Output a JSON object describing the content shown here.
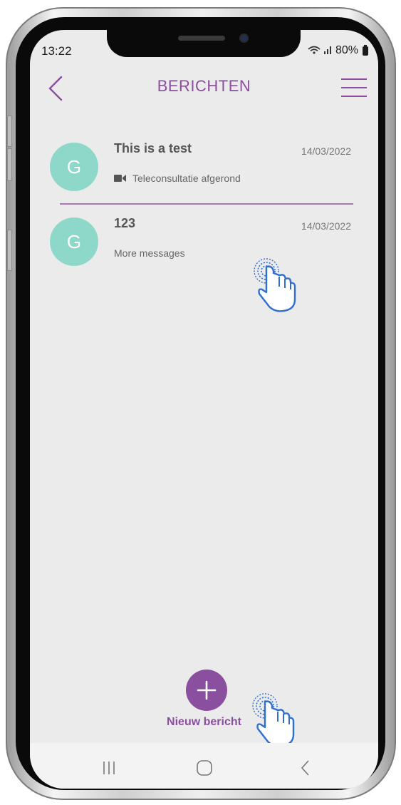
{
  "status_bar": {
    "time": "13:22",
    "battery": "80%",
    "icons": "wifi-icon signal-icon battery-icon"
  },
  "header": {
    "title": "BERICHTEN",
    "back_icon": "chevron-left-icon",
    "menu_icon": "hamburger-menu-icon"
  },
  "messages": [
    {
      "avatar_letter": "G",
      "title": "This is a test",
      "date": "14/03/2022",
      "preview": "Teleconsultatie afgerond",
      "preview_icon": "video-camera-icon"
    },
    {
      "avatar_letter": "G",
      "title": "123",
      "date": "14/03/2022",
      "preview": "More messages"
    }
  ],
  "new_message": {
    "label": "Nieuw bericht",
    "icon": "plus-icon"
  },
  "colors": {
    "accent": "#8a4f9e",
    "avatar": "#8ed8c9",
    "divider": "#a878b4",
    "background": "#ebebeb",
    "hand_hint": "#2f6fd0"
  }
}
